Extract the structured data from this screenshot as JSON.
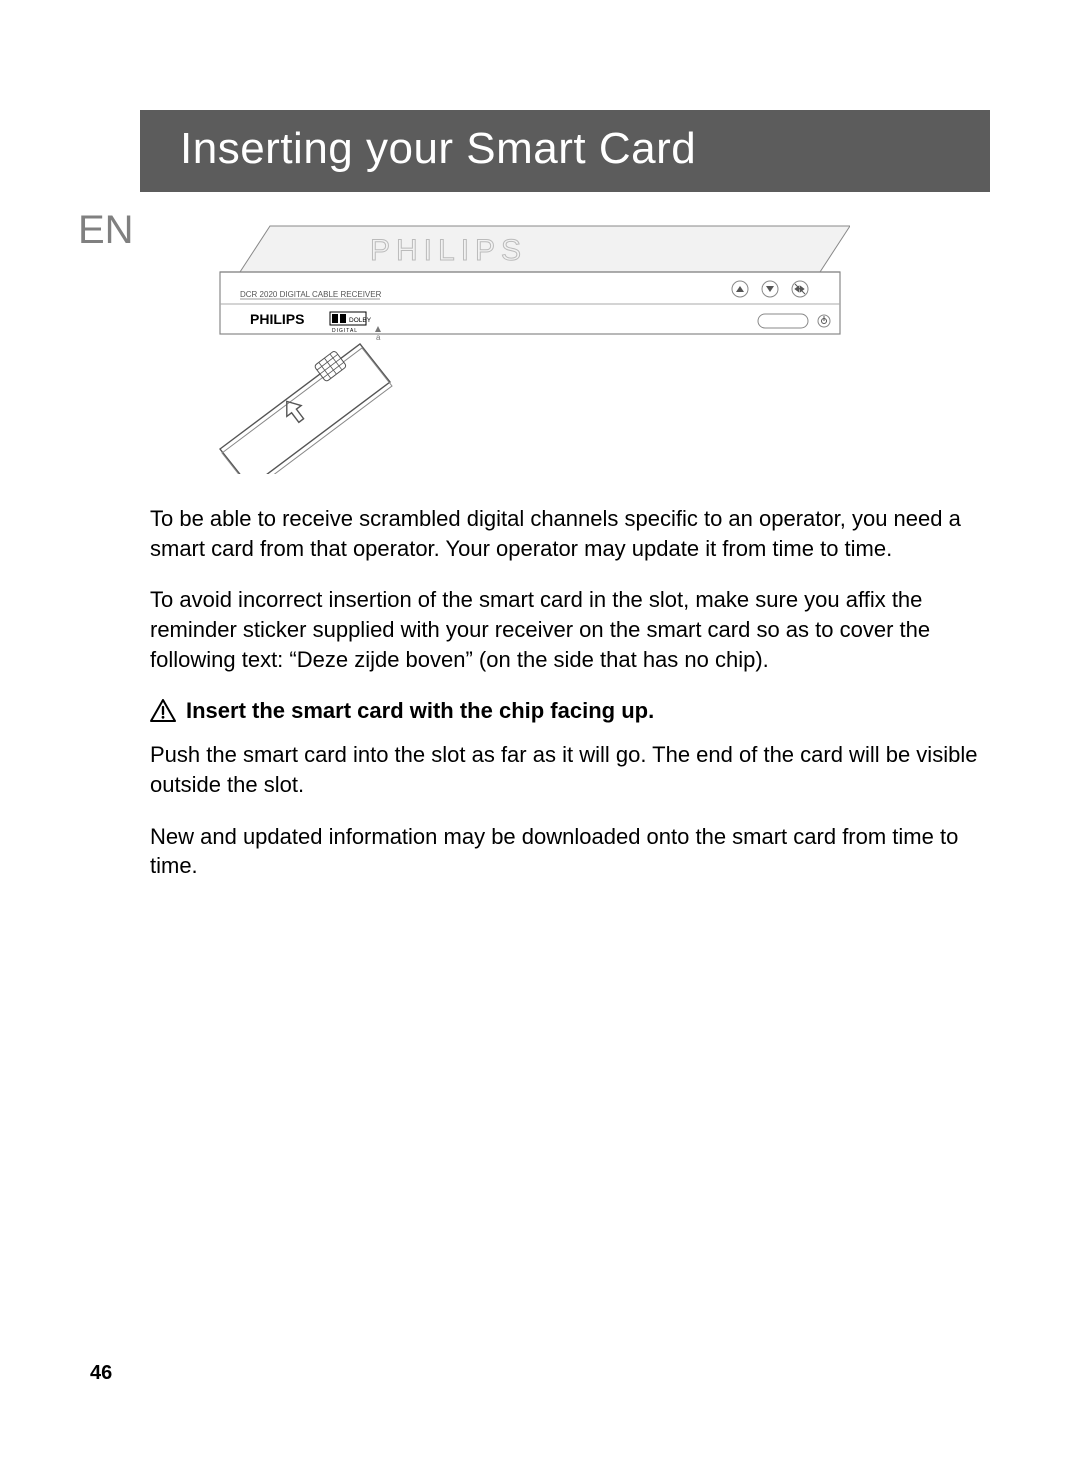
{
  "page": {
    "title": "Inserting your Smart Card",
    "language_tab": "EN",
    "page_number": "46"
  },
  "device": {
    "model_line": "DCR 2020   DIGITAL CABLE RECEIVER",
    "brand": "PHILIPS",
    "dolby": "DOLBY",
    "dolby_sub": "DIGITAL",
    "logo_text": "PHILIPS"
  },
  "body": {
    "p1": "To be able to receive scrambled digital channels specific to an operator, you need a smart card from that operator. Your operator may update it from time to time.",
    "p2": "To avoid incorrect insertion of the smart card in the slot, make sure you affix the reminder sticker supplied with your receiver on the smart card so as to cover the following text: “Deze zijde boven” (on the side that has no chip).",
    "warning": "Insert the smart card with the chip facing up.",
    "p3": "Push the smart card into the slot as far as it will go. The end of the card will be visible outside the slot.",
    "p4": "New and updated information may be downloaded onto the smart card from time to time."
  }
}
